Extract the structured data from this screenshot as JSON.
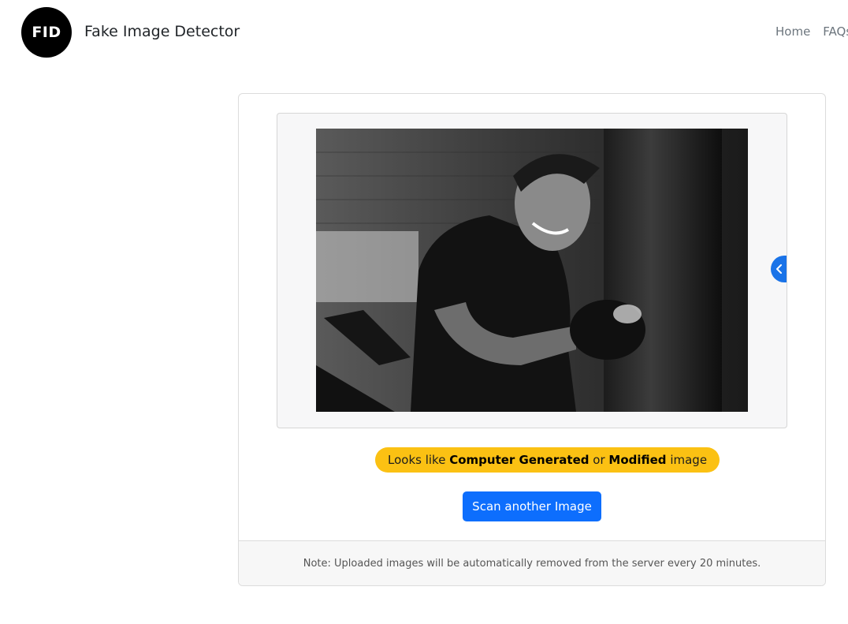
{
  "header": {
    "logo_text": "FID",
    "brand_name": "Fake Image Detector",
    "nav": [
      {
        "label": "Home"
      },
      {
        "label": "FAQs"
      }
    ]
  },
  "result": {
    "image_alt": "black and white photo of a man punching a heavy bag",
    "verdict": {
      "prefix": "Looks like ",
      "strong1": "Computer Generated",
      "middle": " or ",
      "strong2": "Modified",
      "suffix": " image"
    },
    "scan_button_label": "Scan another Image",
    "carousel_icon": "chevron-left-icon",
    "colors": {
      "verdict_bg": "#fbc113",
      "button_bg": "#0d6efd",
      "carousel_bg": "#1a73e8"
    }
  },
  "footer": {
    "note": "Note: Uploaded images will be automatically removed from the server every 20 minutes."
  }
}
